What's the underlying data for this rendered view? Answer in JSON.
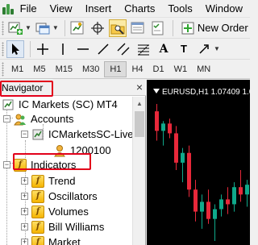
{
  "menu": {
    "items": [
      {
        "label": "File",
        "key": "F"
      },
      {
        "label": "View",
        "key": "V"
      },
      {
        "label": "Insert",
        "key": "I"
      },
      {
        "label": "Charts",
        "key": "C"
      },
      {
        "label": "Tools",
        "key": "T"
      },
      {
        "label": "Window",
        "key": "W"
      }
    ]
  },
  "toolbar": {
    "new_order_label": "New Order"
  },
  "timeframes": {
    "items": [
      "M1",
      "M5",
      "M15",
      "M30",
      "H1",
      "H4",
      "D1",
      "W1",
      "MN"
    ],
    "active": "H1"
  },
  "navigator": {
    "title": "Navigator",
    "close_glyph": "×",
    "tree": {
      "root": "IC Markets (SC) MT4",
      "accounts": "Accounts",
      "account_server": "ICMarketsSC-Live",
      "account_number": "1200100",
      "indicators": "Indicators",
      "children": [
        "Trend",
        "Oscillators",
        "Volumes",
        "Bill Williams",
        "Market"
      ]
    }
  },
  "chart": {
    "symbol_label": "EURUSD,H1  1.07409  1.0",
    "colors": {
      "bull": "#0fa98b",
      "bear": "#e8283a",
      "background": "#000000"
    },
    "candles": [
      {
        "o": 1.075,
        "h": 1.0753,
        "l": 1.0738,
        "c": 1.0742
      },
      {
        "o": 1.0742,
        "h": 1.0746,
        "l": 1.0736,
        "c": 1.0745
      },
      {
        "o": 1.0745,
        "h": 1.0747,
        "l": 1.0739,
        "c": 1.0741
      },
      {
        "o": 1.0741,
        "h": 1.0744,
        "l": 1.0726,
        "c": 1.0729
      },
      {
        "o": 1.0729,
        "h": 1.0735,
        "l": 1.0721,
        "c": 1.0733
      },
      {
        "o": 1.0733,
        "h": 1.0736,
        "l": 1.0715,
        "c": 1.0718
      },
      {
        "o": 1.0718,
        "h": 1.0722,
        "l": 1.0705,
        "c": 1.0709
      },
      {
        "o": 1.0709,
        "h": 1.0716,
        "l": 1.0702,
        "c": 1.0713
      },
      {
        "o": 1.0713,
        "h": 1.0718,
        "l": 1.0704,
        "c": 1.0706
      },
      {
        "o": 1.0706,
        "h": 1.0712,
        "l": 1.0697,
        "c": 1.071
      },
      {
        "o": 1.071,
        "h": 1.0716,
        "l": 1.0707,
        "c": 1.0714
      },
      {
        "o": 1.0714,
        "h": 1.0719,
        "l": 1.0708,
        "c": 1.0712
      },
      {
        "o": 1.0712,
        "h": 1.0721,
        "l": 1.0709,
        "c": 1.0719
      },
      {
        "o": 1.0719,
        "h": 1.0726,
        "l": 1.0713,
        "c": 1.0716
      },
      {
        "o": 1.0716,
        "h": 1.0722,
        "l": 1.0711,
        "c": 1.072
      }
    ]
  }
}
